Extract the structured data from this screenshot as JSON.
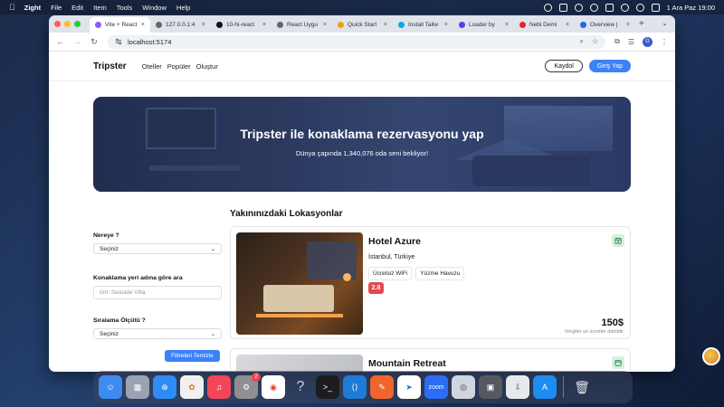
{
  "menubar": {
    "app": "Zight",
    "items": [
      "File",
      "Edit",
      "Item",
      "Tools",
      "Window",
      "Help"
    ],
    "datetime": "1 Ara Paz  19:00"
  },
  "browser": {
    "tabs": [
      {
        "label": "Vite + React",
        "fav_color": "#8b5cf6",
        "active": true
      },
      {
        "label": "127.0.0.1:4",
        "fav_color": "#666666"
      },
      {
        "label": "10-hi-react",
        "fav_color": "#111111"
      },
      {
        "label": "React Uygu",
        "fav_color": "#666666"
      },
      {
        "label": "Quick Start",
        "fav_color": "#f59e0b"
      },
      {
        "label": "Install Tailw",
        "fav_color": "#0ea5e9"
      },
      {
        "label": "Loader by",
        "fav_color": "#4f46e5"
      },
      {
        "label": "Nebi Demi",
        "fav_color": "#dc2626"
      },
      {
        "label": "Overview |",
        "fav_color": "#2563eb"
      }
    ],
    "url": "localhost:5174",
    "profile_initial": "G"
  },
  "site": {
    "logo": "Tripster",
    "nav": [
      "Oteller",
      "Popüler",
      "Oluştur"
    ],
    "register": "Kaydol",
    "login": "Giriş Yap"
  },
  "hero": {
    "title": "Tripster ile konaklama rezervasyonu yap",
    "subtitle": "Dünya çapında 1,340,076 oda seni bekliyor!"
  },
  "section_title": "Yakınınızdaki Lokasyonlar",
  "filters": {
    "where_label": "Nereye ?",
    "where_value": "Seçiniz",
    "name_label": "Konaklama yeri adına göre ara",
    "name_placeholder": "örn: Seaside Villa",
    "sort_label": "Sıralama Ölçütü ?",
    "sort_value": "Seçiniz",
    "clear": "Filtreleri Temizle"
  },
  "hotels": [
    {
      "name": "Hotel Azure",
      "location": "İstanbul, Türkiye",
      "amenities": [
        "Ücretsiz WiFi",
        "Yüzme Havuzu"
      ],
      "rating": "2.8",
      "price": "150$",
      "price_note": "Vergiler ve ücretler dahildir"
    },
    {
      "name": "Mountain Retreat"
    }
  ],
  "colors": {
    "primary": "#3b82f6",
    "rating_bg": "#e5484d",
    "calendar_bg": "#d8efe0"
  },
  "dock": {
    "badge_count": "2",
    "zoom_label": "zoom"
  }
}
